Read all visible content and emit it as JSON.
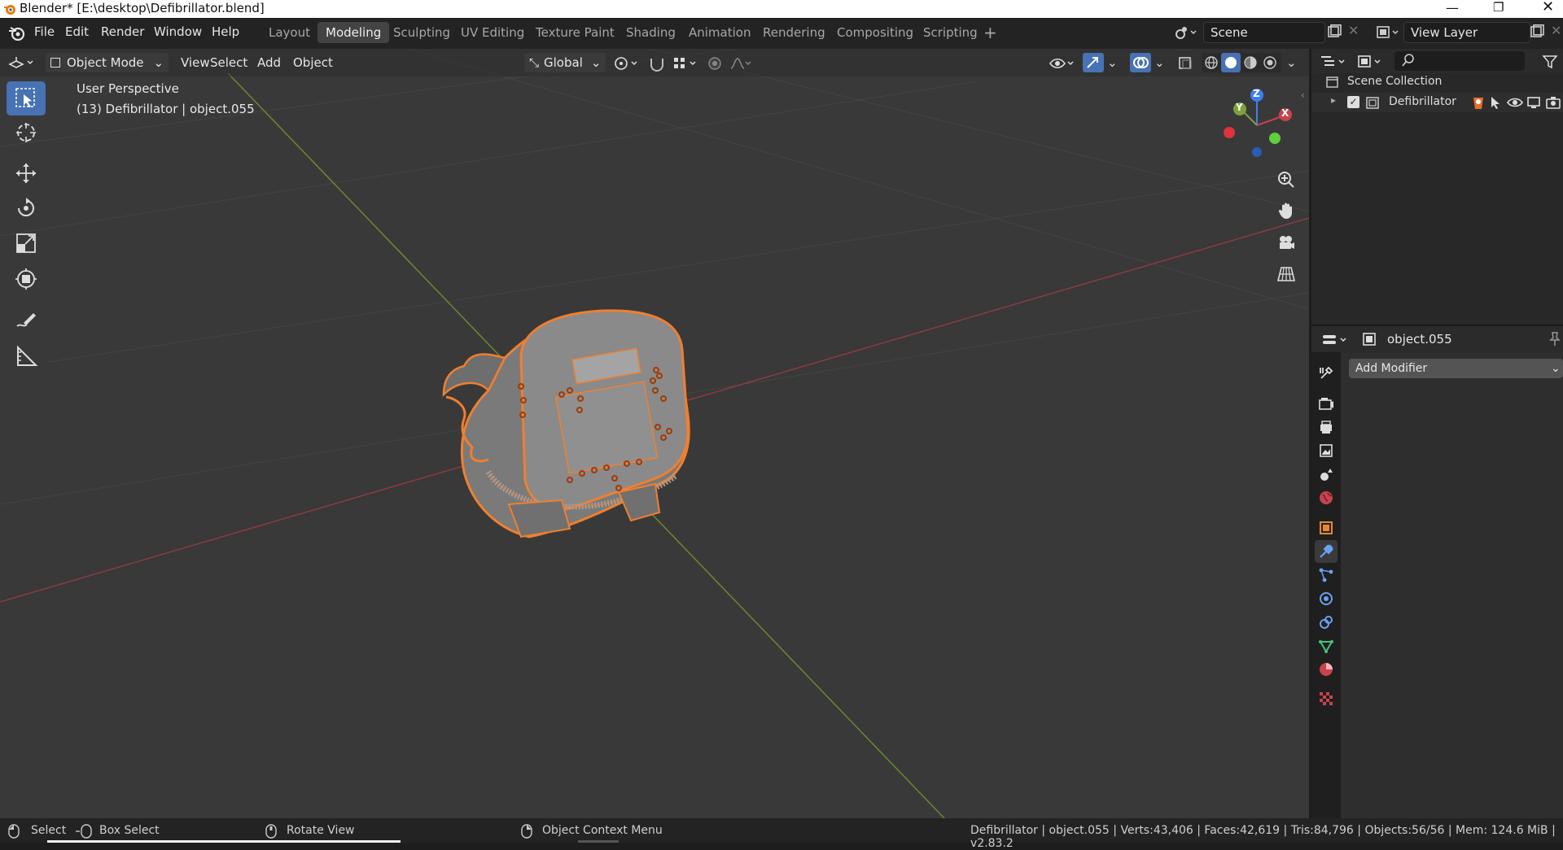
{
  "window": {
    "title": "Blender* [E:\\desktop\\Defibrillator.blend]"
  },
  "menu": {
    "file": "File",
    "edit": "Edit",
    "render": "Render",
    "window": "Window",
    "help": "Help"
  },
  "workspaces": [
    "Layout",
    "Modeling",
    "Sculpting",
    "UV Editing",
    "Texture Paint",
    "Shading",
    "Animation",
    "Rendering",
    "Compositing",
    "Scripting"
  ],
  "scene": {
    "name": "Scene",
    "view_layer": "View Layer"
  },
  "viewport_header": {
    "mode": "Object Mode",
    "view": "View",
    "select": "Select",
    "add": "Add",
    "object": "Object",
    "orientation": "Global"
  },
  "viewport": {
    "perspective": "User Perspective",
    "active": "(13) Defibrillator | object.055"
  },
  "gizmo": {
    "x": "X",
    "y": "Y",
    "z": "Z"
  },
  "outliner": {
    "root": "Scene Collection",
    "collection": "Defibrillator"
  },
  "properties": {
    "object_name": "object.055",
    "add_modifier": "Add Modifier"
  },
  "status": {
    "select": "Select",
    "box_select": "Box Select",
    "rotate": "Rotate View",
    "context_menu": "Object Context Menu",
    "stats": "Defibrillator | object.055 | Verts:43,406 | Faces:42,619 | Tris:84,796 | Objects:56/56 | Mem: 124.6 MiB | v2.83.2"
  },
  "colors": {
    "accent": "#4772b3",
    "selection": "#e5702a",
    "x_axis": "#c8434d",
    "y_axis": "#7ea03a",
    "z_axis": "#3c7ff0"
  }
}
